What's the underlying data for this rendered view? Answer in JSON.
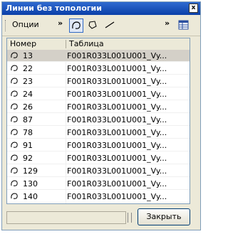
{
  "window": {
    "title": "Линии без топологии",
    "close_glyph": "x"
  },
  "toolbar": {
    "options_label": "Опции",
    "chevron_glyph": "»"
  },
  "table": {
    "columns": [
      "Номер",
      "Таблица"
    ],
    "selected_index": 0,
    "rows": [
      {
        "num": "13",
        "table": "F001R033L001U001_Vy..."
      },
      {
        "num": "22",
        "table": "F001R033L001U001_Vy..."
      },
      {
        "num": "23",
        "table": "F001R033L001U001_Vy..."
      },
      {
        "num": "24",
        "table": "F001R033L001U001_Vy..."
      },
      {
        "num": "26",
        "table": "F001R033L001U001_Vy..."
      },
      {
        "num": "87",
        "table": "F001R033L001U001_Vy..."
      },
      {
        "num": "78",
        "table": "F001R033L001U001_Vy..."
      },
      {
        "num": "91",
        "table": "F001R033L001U001_Vy..."
      },
      {
        "num": "92",
        "table": "F001R033L001U001_Vy..."
      },
      {
        "num": "129",
        "table": "F001R033L001U001_Vy..."
      },
      {
        "num": "130",
        "table": "F001R033L001U001_Vy..."
      },
      {
        "num": "140",
        "table": "F001R033L001U001_Vy..."
      }
    ]
  },
  "footer": {
    "close_label": "Закрыть"
  }
}
